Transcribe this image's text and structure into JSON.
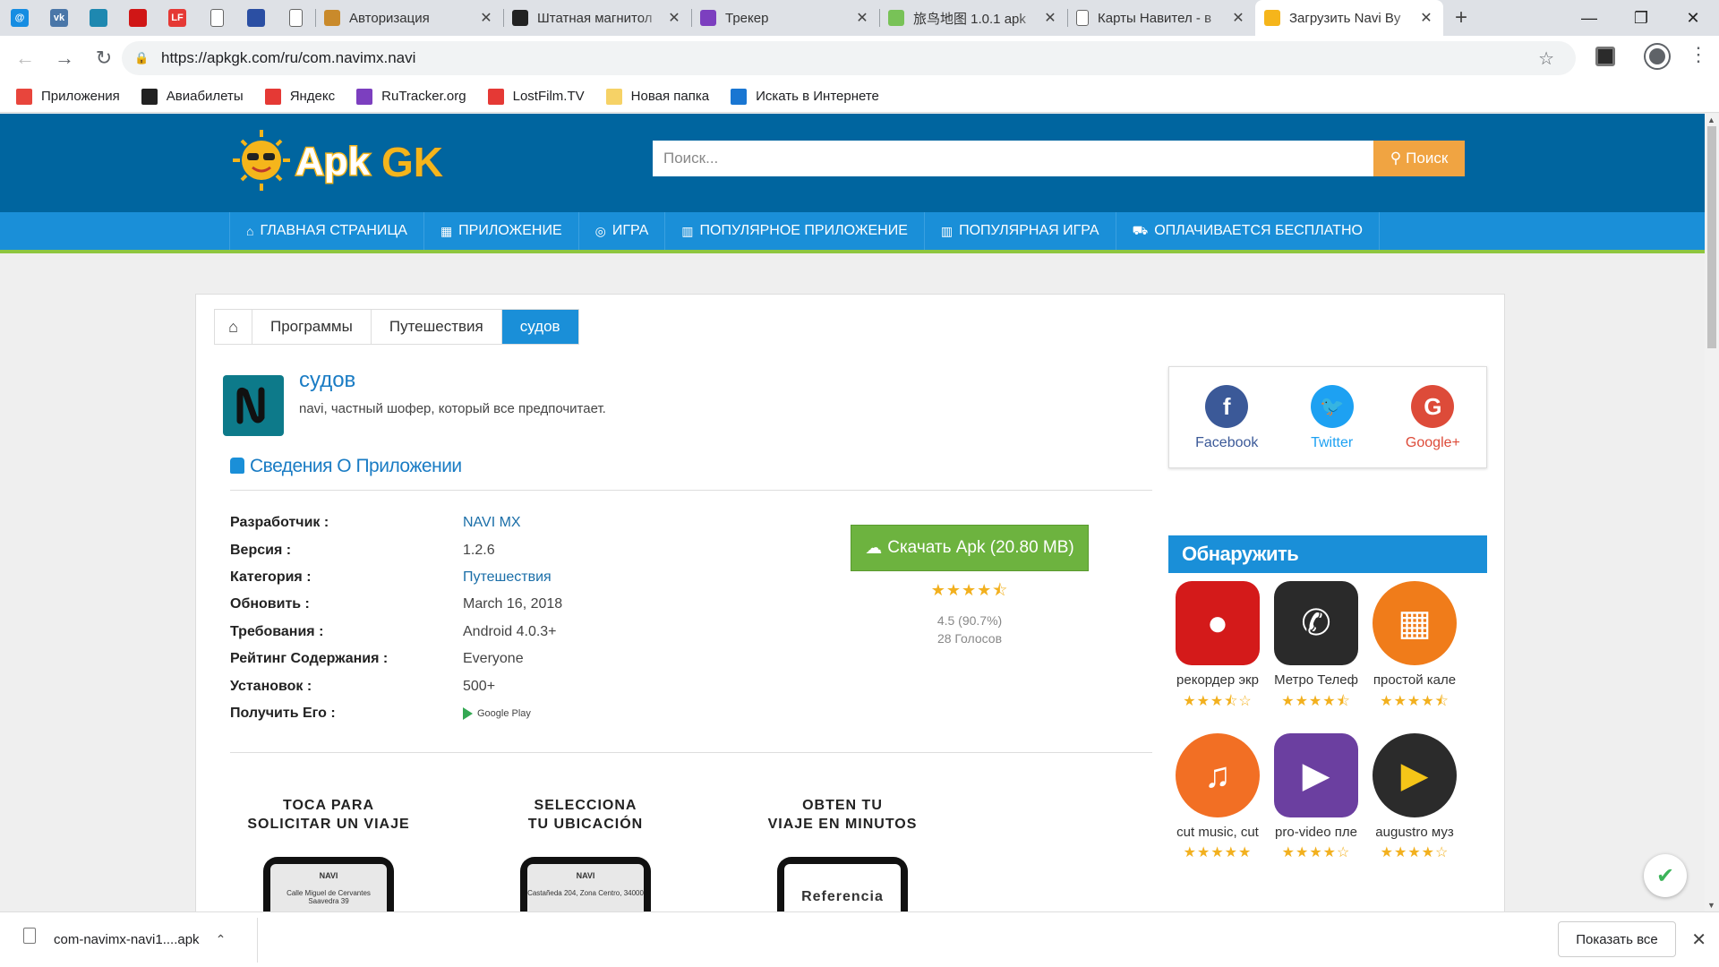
{
  "browser": {
    "pinned_tabs": [
      {
        "icon": "mail-ru-icon",
        "label": "@",
        "color": "#168de2"
      },
      {
        "icon": "vk-icon",
        "label": "vk",
        "color": "#4a76a8"
      },
      {
        "icon": "mosaic-icon",
        "label": "",
        "color": "#1e88b0"
      },
      {
        "icon": "red-square-icon",
        "label": "",
        "color": "#d01616"
      },
      {
        "icon": "lostfilm-icon",
        "label": "LF",
        "color": "#e53935"
      },
      {
        "icon": "doc-icon",
        "label": "",
        "color": "#ffffff"
      },
      {
        "icon": "emblem-icon",
        "label": "",
        "color": "#2b4fa3"
      },
      {
        "icon": "doc-icon",
        "label": "",
        "color": "#ffffff"
      }
    ],
    "tabs": [
      {
        "title": "Авторизация",
        "icon": "avatar-icon",
        "color": "#c98a2b"
      },
      {
        "title": "Штатная магнитол",
        "icon": "z-icon",
        "color": "#222222"
      },
      {
        "title": "Трекер",
        "icon": "rutracker-icon",
        "color": "#7c3fbf"
      },
      {
        "title": "旅鸟地图 1.0.1 apk",
        "icon": "android-icon",
        "color": "#78c257"
      },
      {
        "title": "Карты Навител - в",
        "icon": "doc-icon",
        "color": "#ffffff"
      },
      {
        "title": "Загрузить Navi By",
        "icon": "sun-icon",
        "color": "#f5b51b",
        "active": true
      }
    ],
    "url": "https://apkgk.com/ru/com.navimx.navi",
    "bookmarks": [
      {
        "label": "Приложения",
        "icon": "apps-grid-icon",
        "color": "#e8453c"
      },
      {
        "label": "Авиабилеты",
        "icon": "plane-icon",
        "color": "#222222"
      },
      {
        "label": "Яндекс",
        "icon": "yandex-icon",
        "color": "#e53935"
      },
      {
        "label": "RuTracker.org",
        "icon": "rutracker-icon",
        "color": "#7c3fbf"
      },
      {
        "label": "LostFilm.TV",
        "icon": "lostfilm-icon",
        "color": "#e53935"
      },
      {
        "label": "Новая папка",
        "icon": "folder-icon",
        "color": "#f6d266"
      },
      {
        "label": "Искать в Интернете",
        "icon": "search-icon",
        "color": "#1976d2"
      }
    ]
  },
  "site": {
    "search_placeholder": "Поиск...",
    "search_button": "Поиск",
    "nav": [
      {
        "label": "ГЛАВНАЯ СТРАНИЦА",
        "icon": "home-icon"
      },
      {
        "label": "ПРИЛОЖЕНИЕ",
        "icon": "grid-icon"
      },
      {
        "label": "ИГРА",
        "icon": "gamepad-icon"
      },
      {
        "label": "ПОПУЛЯРНОЕ ПРИЛОЖЕНИЕ",
        "icon": "bar-chart-icon"
      },
      {
        "label": "ПОПУЛЯРНАЯ ИГРА",
        "icon": "bar-chart-icon"
      },
      {
        "label": "ОПЛАЧИВАЕТСЯ БЕСПЛАТНО",
        "icon": "cart-icon"
      }
    ],
    "breadcrumb": [
      "Программы",
      "Путешествия",
      "судов"
    ]
  },
  "app": {
    "title": "судов",
    "subtitle": "navi, частный шофер, который все предпочитает.",
    "section_title": "Сведения О Приложении",
    "details": [
      {
        "key": "Разработчик :",
        "value": "NAVI MX",
        "link": true
      },
      {
        "key": "Версия :",
        "value": "1.2.6"
      },
      {
        "key": "Категория :",
        "value": "Путешествия",
        "link": true
      },
      {
        "key": "Обновить :",
        "value": "March 16, 2018"
      },
      {
        "key": "Требования :",
        "value": "Android 4.0.3+"
      },
      {
        "key": "Рейтинг Содержания :",
        "value": "Everyone"
      },
      {
        "key": "Установок :",
        "value": "500+"
      },
      {
        "key": "Получить Его :",
        "value": "Google Play",
        "gplay": true
      }
    ],
    "download_button": "Скачать Apk (20.80 MB)",
    "rating_value": 4.5,
    "rating_text": "4.5 (90.7%)",
    "votes": "28 Голосов",
    "screenshots": [
      {
        "caption1": "TOCA PARA",
        "caption2": "SOLICITAR UN VIAJE",
        "screen_title": "NAVI",
        "screen_text": "Calle Miguel de Cervantes Saavedra 39"
      },
      {
        "caption1": "SELECCIONA",
        "caption2": "TU UBICACIÓN",
        "screen_title": "NAVI",
        "screen_text": "Castañeda 204, Zona Centro, 34000"
      },
      {
        "caption1": "OBTEN TU",
        "caption2": "VIAJE EN MINUTOS",
        "screen_title": "",
        "screen_text": "Referencia"
      }
    ]
  },
  "social": [
    {
      "label": "Facebook",
      "icon": "facebook-icon",
      "color": "#3b5998",
      "text_color": "#3b5998"
    },
    {
      "label": "Twitter",
      "icon": "twitter-icon",
      "color": "#1da1f2",
      "text_color": "#1da1f2"
    },
    {
      "label": "Google+",
      "icon": "google-plus-icon",
      "color": "#dd4b39",
      "text_color": "#dd4b39"
    }
  ],
  "discover": {
    "title": "Обнаружить",
    "apps": [
      {
        "name": "рекордер экр",
        "stars": 3.5,
        "color": "#d41a1a",
        "icon": "screen-recorder-icon"
      },
      {
        "name": "Метро Телеф",
        "stars": 4.5,
        "color": "#2a2a2a",
        "icon": "phone-icon"
      },
      {
        "name": "простой кале",
        "stars": 4.5,
        "color": "#f07c1a",
        "icon": "calendar-icon"
      },
      {
        "name": "cut music, cut",
        "stars": 5,
        "color": "#f26f24",
        "icon": "music-icon"
      },
      {
        "name": "pro-video пле",
        "stars": 4,
        "color": "#6b3fa0",
        "icon": "play-icon"
      },
      {
        "name": "augustro муз",
        "stars": 4,
        "color": "#2b2b2b",
        "icon": "play-icon"
      }
    ]
  },
  "downloads": {
    "file": "com-navimx-navi1....apk",
    "show_all": "Показать все"
  }
}
